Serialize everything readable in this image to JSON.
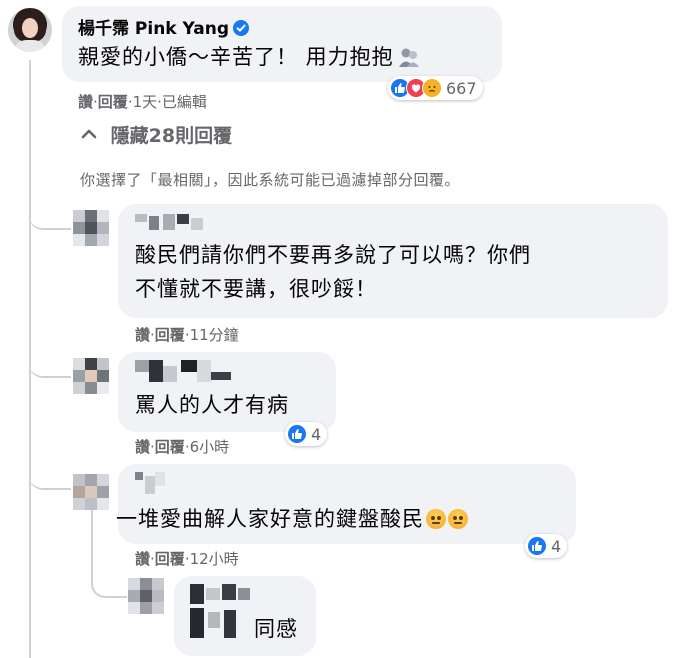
{
  "top_comment": {
    "author": "楊千霈 Pink Yang",
    "text": "親愛的小僑～辛苦了！ 用力抱抱",
    "actions": [
      "讚",
      "回覆",
      "1天",
      "已編輯"
    ],
    "reaction_count": "667",
    "reaction_types": [
      "like-icon",
      "love-icon",
      "sad-icon"
    ]
  },
  "replies_toggle": {
    "label": "隱藏28則回覆",
    "notice": "你選擇了「最相關」，因此系統可能已過濾掉部分回覆。"
  },
  "replies": [
    {
      "text_lines": [
        "酸民們請你們不要再多說了可以嗎？你們",
        "不懂就不要講，很吵餒！"
      ],
      "actions": [
        "讚",
        "回覆",
        "11分鐘"
      ]
    },
    {
      "text_lines": [
        "罵人的人才有病"
      ],
      "actions": [
        "讚",
        "回覆",
        "6小時"
      ],
      "reaction_count": "4"
    },
    {
      "text_lines": [
        "一堆愛曲解人家好意的鍵盤酸民"
      ],
      "actions": [
        "讚",
        "回覆",
        "12小時"
      ],
      "reaction_count": "4"
    },
    {
      "text_lines": [
        "同感"
      ]
    }
  ],
  "colors": {
    "bubble": "#f0f2f5",
    "meta_text": "#65676b",
    "like_blue": "#1877f2",
    "love_red": "#f33e58",
    "thread_line": "#ced0d4"
  }
}
